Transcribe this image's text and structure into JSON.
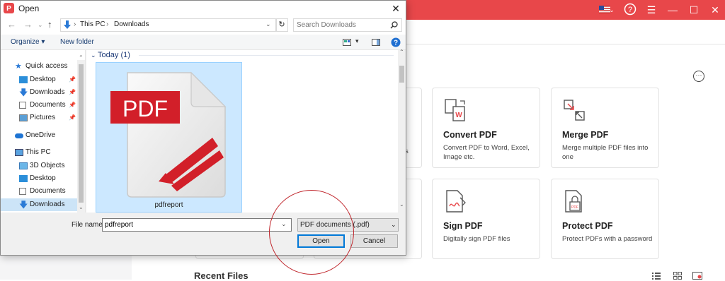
{
  "dialog": {
    "title": "Open",
    "breadcrumb": [
      "This PC",
      "Downloads"
    ],
    "search_placeholder": "Search Downloads",
    "toolbar": {
      "organize": "Organize ▾",
      "new_folder": "New folder"
    },
    "nav_items": [
      {
        "label": "Quick access",
        "icon": "star-icon",
        "pinned": false
      },
      {
        "label": "Desktop",
        "icon": "desktop-icon",
        "pinned": true
      },
      {
        "label": "Downloads",
        "icon": "download-icon",
        "pinned": true
      },
      {
        "label": "Documents",
        "icon": "document-icon",
        "pinned": true
      },
      {
        "label": "Pictures",
        "icon": "picture-icon",
        "pinned": true
      },
      {
        "label": "OneDrive",
        "icon": "cloud-icon",
        "pinned": false
      },
      {
        "label": "This PC",
        "icon": "computer-icon",
        "pinned": false
      },
      {
        "label": "3D Objects",
        "icon": "cube-icon",
        "pinned": false
      },
      {
        "label": "Desktop",
        "icon": "desktop-icon",
        "pinned": false
      },
      {
        "label": "Documents",
        "icon": "document-icon",
        "pinned": false
      },
      {
        "label": "Downloads",
        "icon": "download-icon",
        "pinned": false,
        "selected": true
      }
    ],
    "group_header": "Today (1)",
    "file": {
      "name": "pdfreport",
      "icon_text": "PDF"
    },
    "file_name_label": "File name:",
    "file_name_value": "pdfreport",
    "file_type": "PDF documents (.pdf)",
    "open_label": "Open",
    "cancel_label": "Cancel"
  },
  "app": {
    "accent_color": "#e8474a",
    "cards": [
      {
        "title": "Convert PDF",
        "desc": "Convert PDF to Word, Excel, Image etc.",
        "icon": "convert-pdf-icon"
      },
      {
        "title": "Merge PDF",
        "desc": "Merge multiple PDF files into one",
        "icon": "merge-pdf-icon"
      },
      {
        "title": "Sign PDF",
        "desc": "Digitally sign PDF files",
        "icon": "sign-pdf-icon"
      },
      {
        "title": "Protect PDF",
        "desc": "Protect PDFs with a password",
        "icon": "protect-pdf-icon"
      }
    ],
    "recent_files": "Recent Files",
    "partial_text": "s"
  }
}
